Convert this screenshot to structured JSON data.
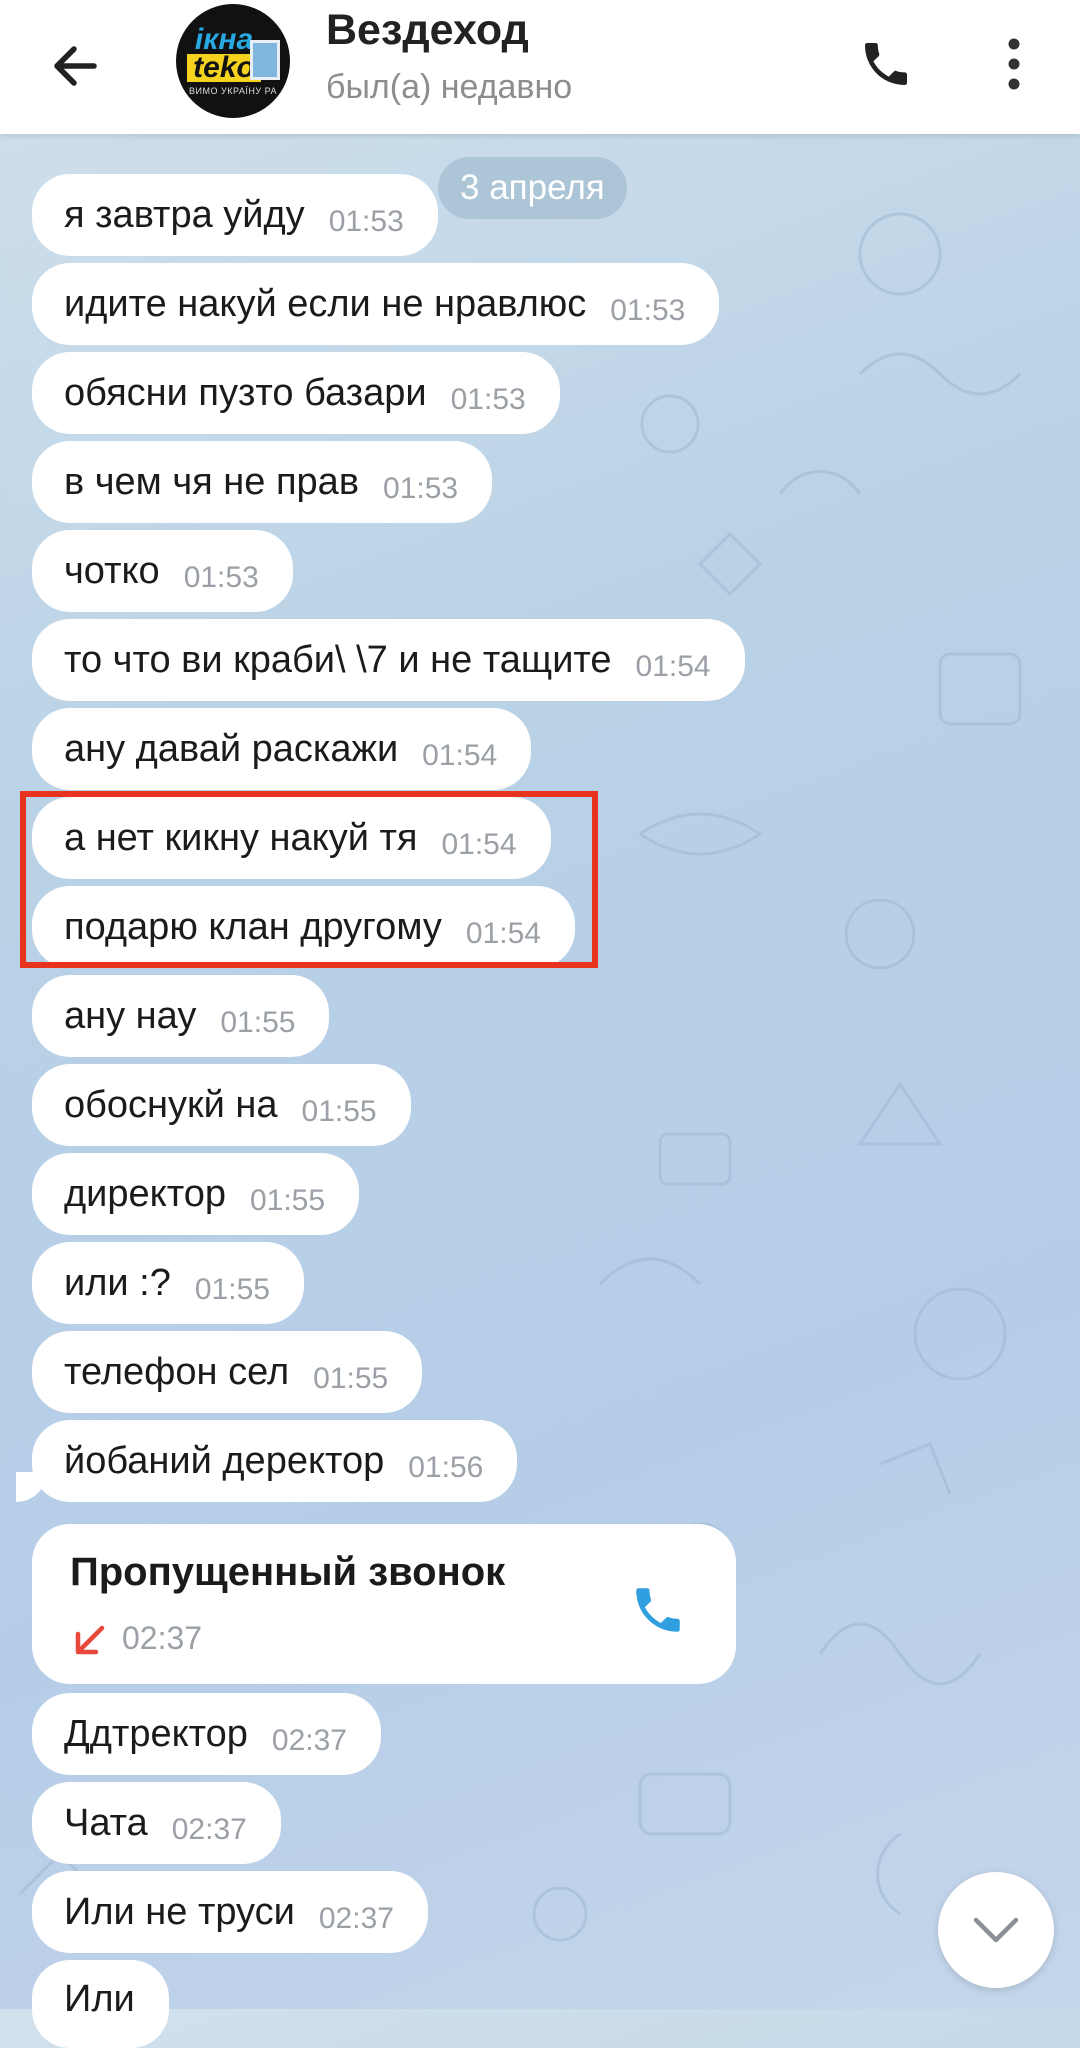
{
  "header": {
    "title": "Вездеход",
    "status": "был(а) недавно",
    "avatar": {
      "line1": "ікна",
      "line2": "teko",
      "line3": "ВИМО УКРАЇНУ РА"
    },
    "back_icon": "arrow-left-icon",
    "call_icon": "phone-icon",
    "menu_icon": "more-vertical-icon"
  },
  "date_chip": "3 апреля",
  "messages": [
    {
      "text": "я  завтра уйду",
      "time": "01:53"
    },
    {
      "text": "идите накуй    если не нравлюс",
      "time": "01:53"
    },
    {
      "text": "обясни  пузто    базари",
      "time": "01:53"
    },
    {
      "text": "в чем чя не прав",
      "time": "01:53"
    },
    {
      "text": "чотко",
      "time": "01:53"
    },
    {
      "text": "то что  ви краби\\  \\7 и не тащите",
      "time": "01:54"
    },
    {
      "text": "ану     давай раскажи",
      "time": "01:54"
    },
    {
      "text": "а  нет кикну накуй  тя",
      "time": "01:54"
    },
    {
      "text": "подарю клан другому",
      "time": "01:54"
    },
    {
      "text": "ану нау",
      "time": "01:55"
    },
    {
      "text": "обоснукй    на",
      "time": "01:55"
    },
    {
      "text": "директор",
      "time": "01:55"
    },
    {
      "text": "или :?",
      "time": "01:55"
    },
    {
      "text": "телефон сел",
      "time": "01:55"
    },
    {
      "text": "йобаний  деректор",
      "time": "01:56"
    },
    {
      "text": "Ддтректор",
      "time": "02:37"
    },
    {
      "text": "Чата",
      "time": "02:37"
    },
    {
      "text": "Или   не  труси",
      "time": "02:37"
    },
    {
      "text": "Или",
      "time": ""
    }
  ],
  "missed_call": {
    "title": "Пропущенный звонок",
    "time": "02:37",
    "arrow_icon": "missed-call-arrow-icon",
    "call_icon": "phone-icon"
  },
  "colors": {
    "accent": "#2f9fe0",
    "missed": "#e8473b",
    "highlight": "#e8331f",
    "bubble": "#ffffff",
    "time": "#9aa0a5"
  },
  "scroll_down_icon": "chevron-down-icon"
}
